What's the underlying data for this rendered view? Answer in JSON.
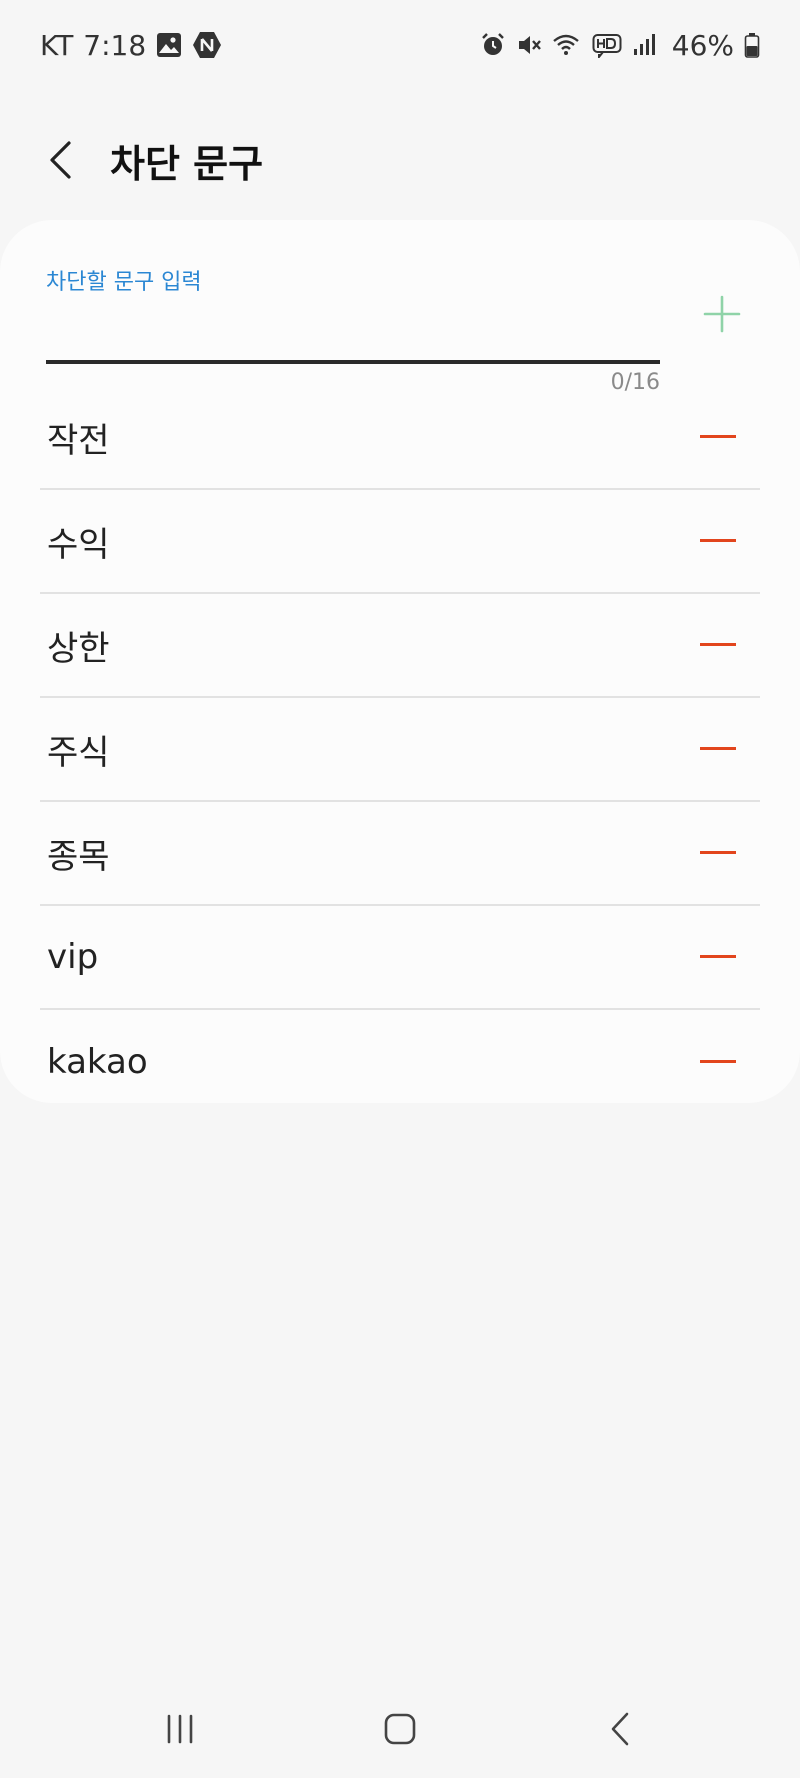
{
  "status_bar": {
    "carrier": "KT",
    "time": "7:18",
    "battery_level": "46%",
    "left_icons": [
      "gallery-icon",
      "naver-icon"
    ],
    "right_icons": [
      "alarm-icon",
      "mute-icon",
      "wifi-icon",
      "hd-voice-icon",
      "signal-icon",
      "battery-icon"
    ]
  },
  "header": {
    "title": "차단 문구",
    "back_icon": "chevron-left-icon"
  },
  "input": {
    "label": "차단할 문구 입력",
    "value": "",
    "counter": "0/16",
    "add_icon": "plus-icon"
  },
  "phrases": [
    {
      "text": "작전"
    },
    {
      "text": "수익"
    },
    {
      "text": "상한"
    },
    {
      "text": "주식"
    },
    {
      "text": "종목"
    },
    {
      "text": "vip"
    },
    {
      "text": "kakao"
    }
  ],
  "nav": {
    "icons": [
      "recent-apps-icon",
      "home-icon",
      "back-icon"
    ]
  },
  "colors": {
    "accent_blue": "#2b87d3",
    "add_green": "#8fd3a8",
    "remove_red": "#e2451d",
    "background": "#f6f6f6",
    "card": "#fcfcfc"
  }
}
